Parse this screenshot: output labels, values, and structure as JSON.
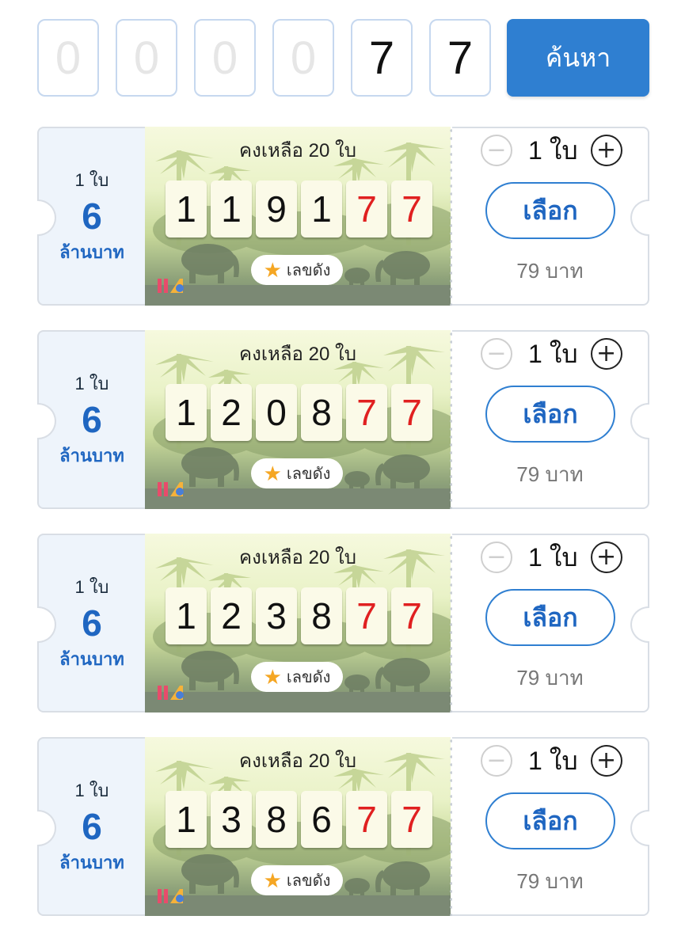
{
  "search": {
    "digits": [
      {
        "value": "0",
        "filled": false
      },
      {
        "value": "0",
        "filled": false
      },
      {
        "value": "0",
        "filled": false
      },
      {
        "value": "0",
        "filled": false
      },
      {
        "value": "7",
        "filled": true
      },
      {
        "value": "7",
        "filled": true
      }
    ],
    "button_label": "ค้นหา"
  },
  "tickets": [
    {
      "qty_label": "1 ใบ",
      "prize": "6",
      "prize_unit": "ล้านบาท",
      "remaining": "คงเหลือ 20 ใบ",
      "number": [
        "1",
        "1",
        "9",
        "1",
        "7",
        "7"
      ],
      "hot_label": "เลขดัง",
      "selected_qty": "1 ใบ",
      "select_label": "เลือก",
      "price": "79 บาท"
    },
    {
      "qty_label": "1 ใบ",
      "prize": "6",
      "prize_unit": "ล้านบาท",
      "remaining": "คงเหลือ 20 ใบ",
      "number": [
        "1",
        "2",
        "0",
        "8",
        "7",
        "7"
      ],
      "hot_label": "เลขดัง",
      "selected_qty": "1 ใบ",
      "select_label": "เลือก",
      "price": "79 บาท"
    },
    {
      "qty_label": "1 ใบ",
      "prize": "6",
      "prize_unit": "ล้านบาท",
      "remaining": "คงเหลือ 20 ใบ",
      "number": [
        "1",
        "2",
        "3",
        "8",
        "7",
        "7"
      ],
      "hot_label": "เลขดัง",
      "selected_qty": "1 ใบ",
      "select_label": "เลือก",
      "price": "79 บาท"
    },
    {
      "qty_label": "1 ใบ",
      "prize": "6",
      "prize_unit": "ล้านบาท",
      "remaining": "คงเหลือ 20 ใบ",
      "number": [
        "1",
        "3",
        "8",
        "6",
        "7",
        "7"
      ],
      "hot_label": "เลขดัง",
      "selected_qty": "1 ใบ",
      "select_label": "เลือก",
      "price": "79 บาท"
    }
  ],
  "colors": {
    "accent": "#2f7fd1",
    "prize_blue": "#1f66c1",
    "matched_digit": "#e02020"
  },
  "icons": {
    "minus": "minus-circle-icon",
    "plus": "plus-circle-icon",
    "hot": "star-icon"
  }
}
